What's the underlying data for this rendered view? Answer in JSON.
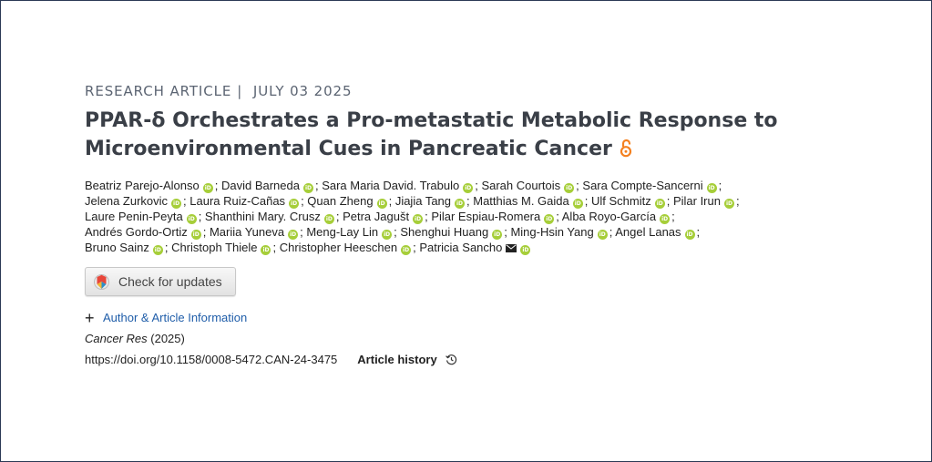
{
  "article": {
    "type": "RESEARCH ARTICLE",
    "date": "JULY 03 2025",
    "separator": "|",
    "title": "PPAR-δ Orchestrates a Pro-metastatic Metabolic Response to Microenvironmental Cues in Pancreatic Cancer",
    "open_access_icon": "open-lock-icon",
    "authors_lines": [
      [
        {
          "name": "Beatriz Parejo-Alonso",
          "orcid": true
        },
        {
          "name": "David Barneda",
          "orcid": true
        },
        {
          "name": "Sara Maria David. Trabulo",
          "orcid": true
        },
        {
          "name": "Sarah Courtois",
          "orcid": true
        },
        {
          "name": "Sara Compte-Sancerni",
          "orcid": true
        }
      ],
      [
        {
          "name": "Jelena Zurkovic",
          "orcid": true
        },
        {
          "name": "Laura Ruiz-Cañas",
          "orcid": true
        },
        {
          "name": "Quan Zheng",
          "orcid": true
        },
        {
          "name": "Jiajia Tang",
          "orcid": true
        },
        {
          "name": "Matthias M. Gaida",
          "orcid": true
        },
        {
          "name": "Ulf Schmitz",
          "orcid": true
        },
        {
          "name": "Pilar Irun",
          "orcid": true
        }
      ],
      [
        {
          "name": "Laure Penin-Peyta",
          "orcid": true
        },
        {
          "name": "Shanthini Mary. Crusz",
          "orcid": true
        },
        {
          "name": "Petra Jagušt",
          "orcid": true
        },
        {
          "name": "Pilar Espiau-Romera",
          "orcid": true
        },
        {
          "name": "Alba Royo-García",
          "orcid": true
        }
      ],
      [
        {
          "name": "Andrés Gordo-Ortiz",
          "orcid": true
        },
        {
          "name": "Mariia Yuneva",
          "orcid": true
        },
        {
          "name": "Meng-Lay Lin",
          "orcid": true
        },
        {
          "name": "Shenghui Huang",
          "orcid": true
        },
        {
          "name": "Ming-Hsin Yang",
          "orcid": true
        },
        {
          "name": "Angel Lanas",
          "orcid": true
        }
      ],
      [
        {
          "name": "Bruno Sainz",
          "orcid": true
        },
        {
          "name": "Christoph Thiele",
          "orcid": true
        },
        {
          "name": "Christopher Heeschen",
          "orcid": true
        },
        {
          "name": "Patricia Sancho",
          "orcid": true,
          "corresponding": true
        }
      ]
    ],
    "orcid_label": "iD",
    "check_for_updates_label": "Check for updates",
    "author_info_label": "Author & Article Information",
    "journal": "Cancer Res",
    "year": "(2025)",
    "doi": "https://doi.org/10.1158/0008-5472.CAN-24-3475",
    "article_history_label": "Article history"
  },
  "colors": {
    "orcid_green": "#a6ce39",
    "link_blue": "#1f5da9",
    "open_access_orange": "#f48120",
    "title_text": "#3a3f47",
    "meta_text": "#5b6472"
  }
}
